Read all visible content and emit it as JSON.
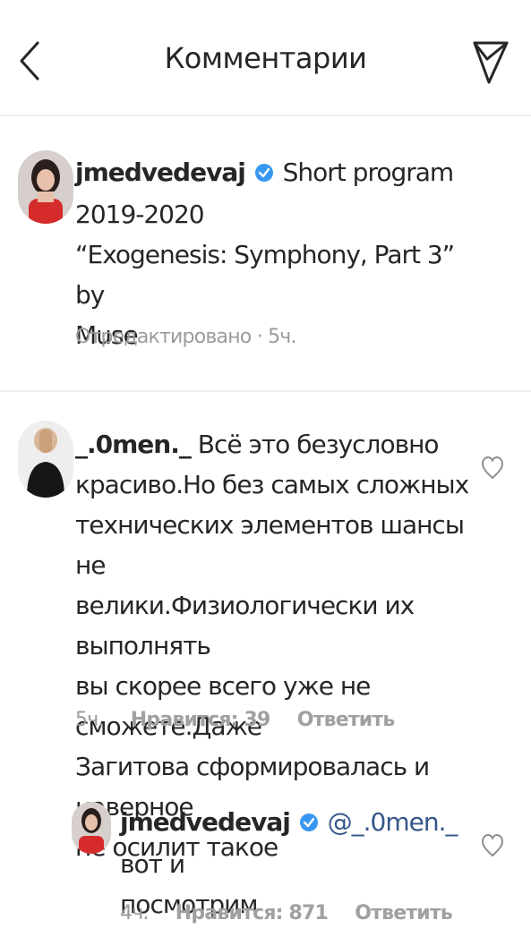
{
  "header": {
    "title": "Комментарии",
    "back_icon": "chevron-left-icon",
    "share_icon": "paper-plane-icon"
  },
  "caption": {
    "username": "jmedvedevaj",
    "verified": true,
    "lines": [
      "Short program",
      "2019-2020",
      "“Exogenesis: Symphony, Part 3” by",
      "Muse"
    ],
    "edited_label": "Отредактировано",
    "separator": "·",
    "time": "5ч."
  },
  "comment": {
    "username": "_.0men._",
    "text_first": "Всё это безусловно",
    "lines": [
      "красиво.Но без самых сложных",
      "технических элементов шансы не",
      "велики.Физиологически их выполнять",
      "вы скорее всего уже не сможете.Даже",
      "Загитова сформировалась и наверное",
      "не осилит такое"
    ],
    "time": "5ч.",
    "likes": "Нравится: 39",
    "reply_label": "Ответить"
  },
  "reply": {
    "username": "jmedvedevaj",
    "verified": true,
    "mention": "@_.0men._",
    "text_first": "вот и",
    "lines": [
      "посмотрим"
    ],
    "time": "4ч.",
    "likes": "Нравится: 871",
    "reply_label": "Ответить"
  },
  "colors": {
    "verified_blue": "#3897f0",
    "mention": "#36568a",
    "meta_gray": "#9b9b9b",
    "divider": "#ececec"
  }
}
